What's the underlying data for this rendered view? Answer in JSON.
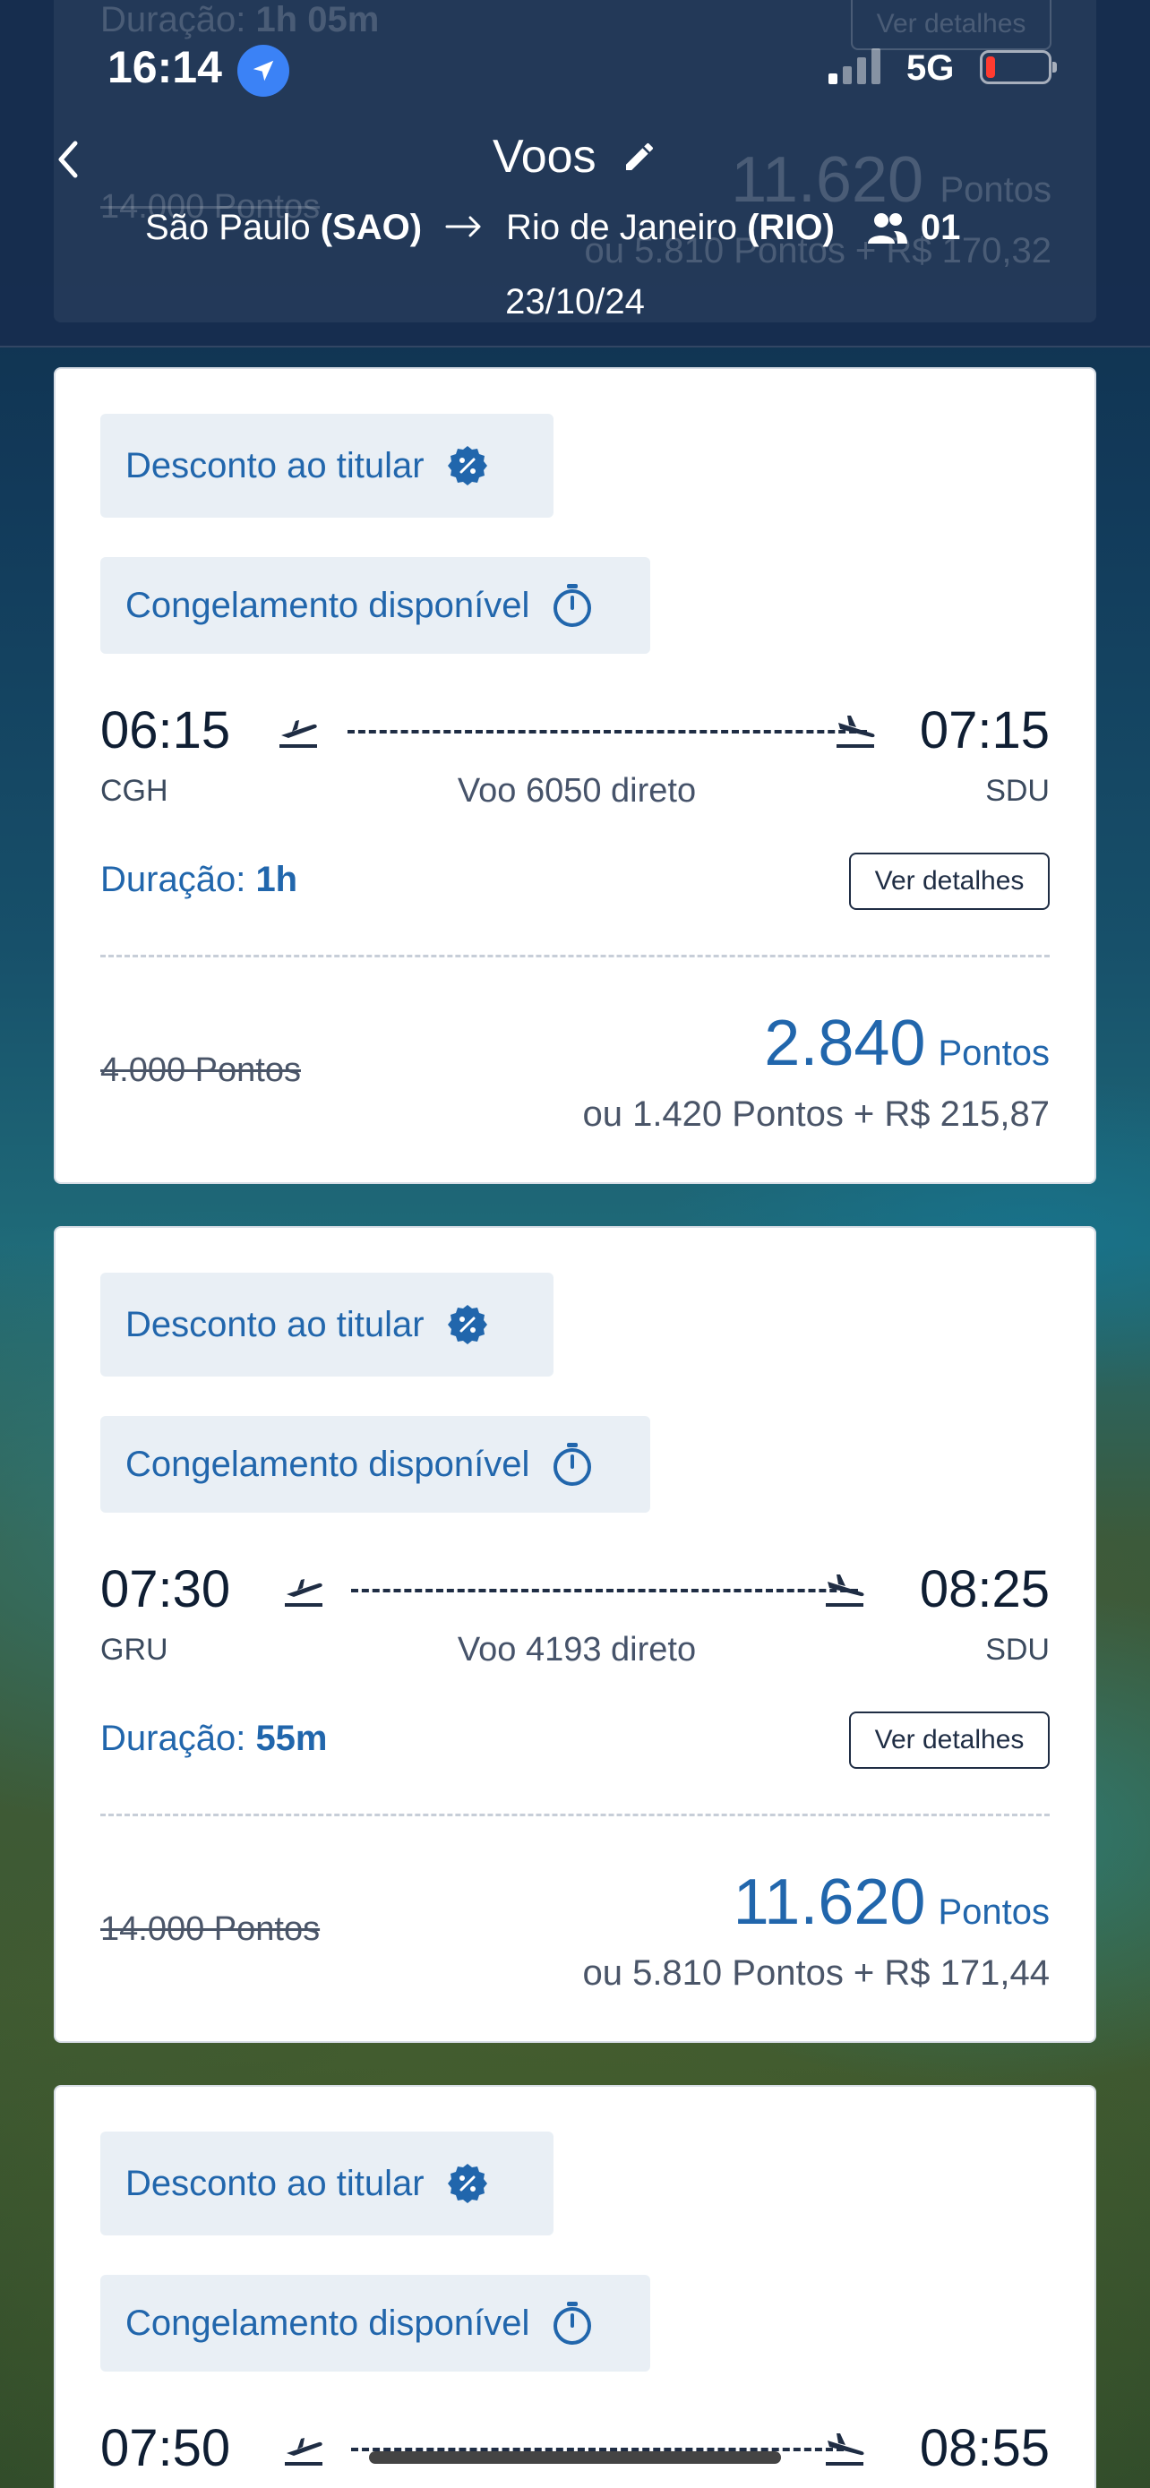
{
  "status_bar": {
    "time": "16:14",
    "network": "5G"
  },
  "header": {
    "title": "Voos",
    "origin_city": "São Paulo",
    "origin_code": "(SAO)",
    "destination_city": "Rio de Janeiro",
    "destination_code": "(RIO)",
    "passengers": "01",
    "date": "23/10/24",
    "behind_duration_label": "Duração:",
    "behind_duration_value": "1h 05m",
    "behind_details": "Ver detalhes",
    "behind_old_price": "14.000 Pontos",
    "behind_price": "11.620",
    "behind_price_unit": "Pontos",
    "behind_alt": "ou 5.810 Pontos + R$ 170,32"
  },
  "flights": [
    {
      "badge_discount": "Desconto ao titular",
      "badge_freeze": "Congelamento disponível",
      "departure_time": "06:15",
      "arrival_time": "07:15",
      "from": "CGH",
      "to": "SDU",
      "flight_info": "Voo 6050 direto",
      "duration_label": "Duração:",
      "duration_value": "1h",
      "details_label": "Ver detalhes",
      "old_price": "4.000 Pontos",
      "price": "2.840",
      "price_unit": "Pontos",
      "alt_price": "ou 1.420 Pontos + R$ 215,87"
    },
    {
      "badge_discount": "Desconto ao titular",
      "badge_freeze": "Congelamento disponível",
      "departure_time": "07:30",
      "arrival_time": "08:25",
      "from": "GRU",
      "to": "SDU",
      "flight_info": "Voo 4193 direto",
      "duration_label": "Duração:",
      "duration_value": "55m",
      "details_label": "Ver detalhes",
      "old_price": "14.000 Pontos",
      "price": "11.620",
      "price_unit": "Pontos",
      "alt_price": "ou 5.810 Pontos + R$ 171,44"
    },
    {
      "badge_discount": "Desconto ao titular",
      "badge_freeze": "Congelamento disponível",
      "departure_time": "07:50",
      "arrival_time": "08:55"
    }
  ],
  "colors": {
    "accent": "#2166ac",
    "header_bg": "#172d4f",
    "badge_bg": "#e9eff5"
  }
}
